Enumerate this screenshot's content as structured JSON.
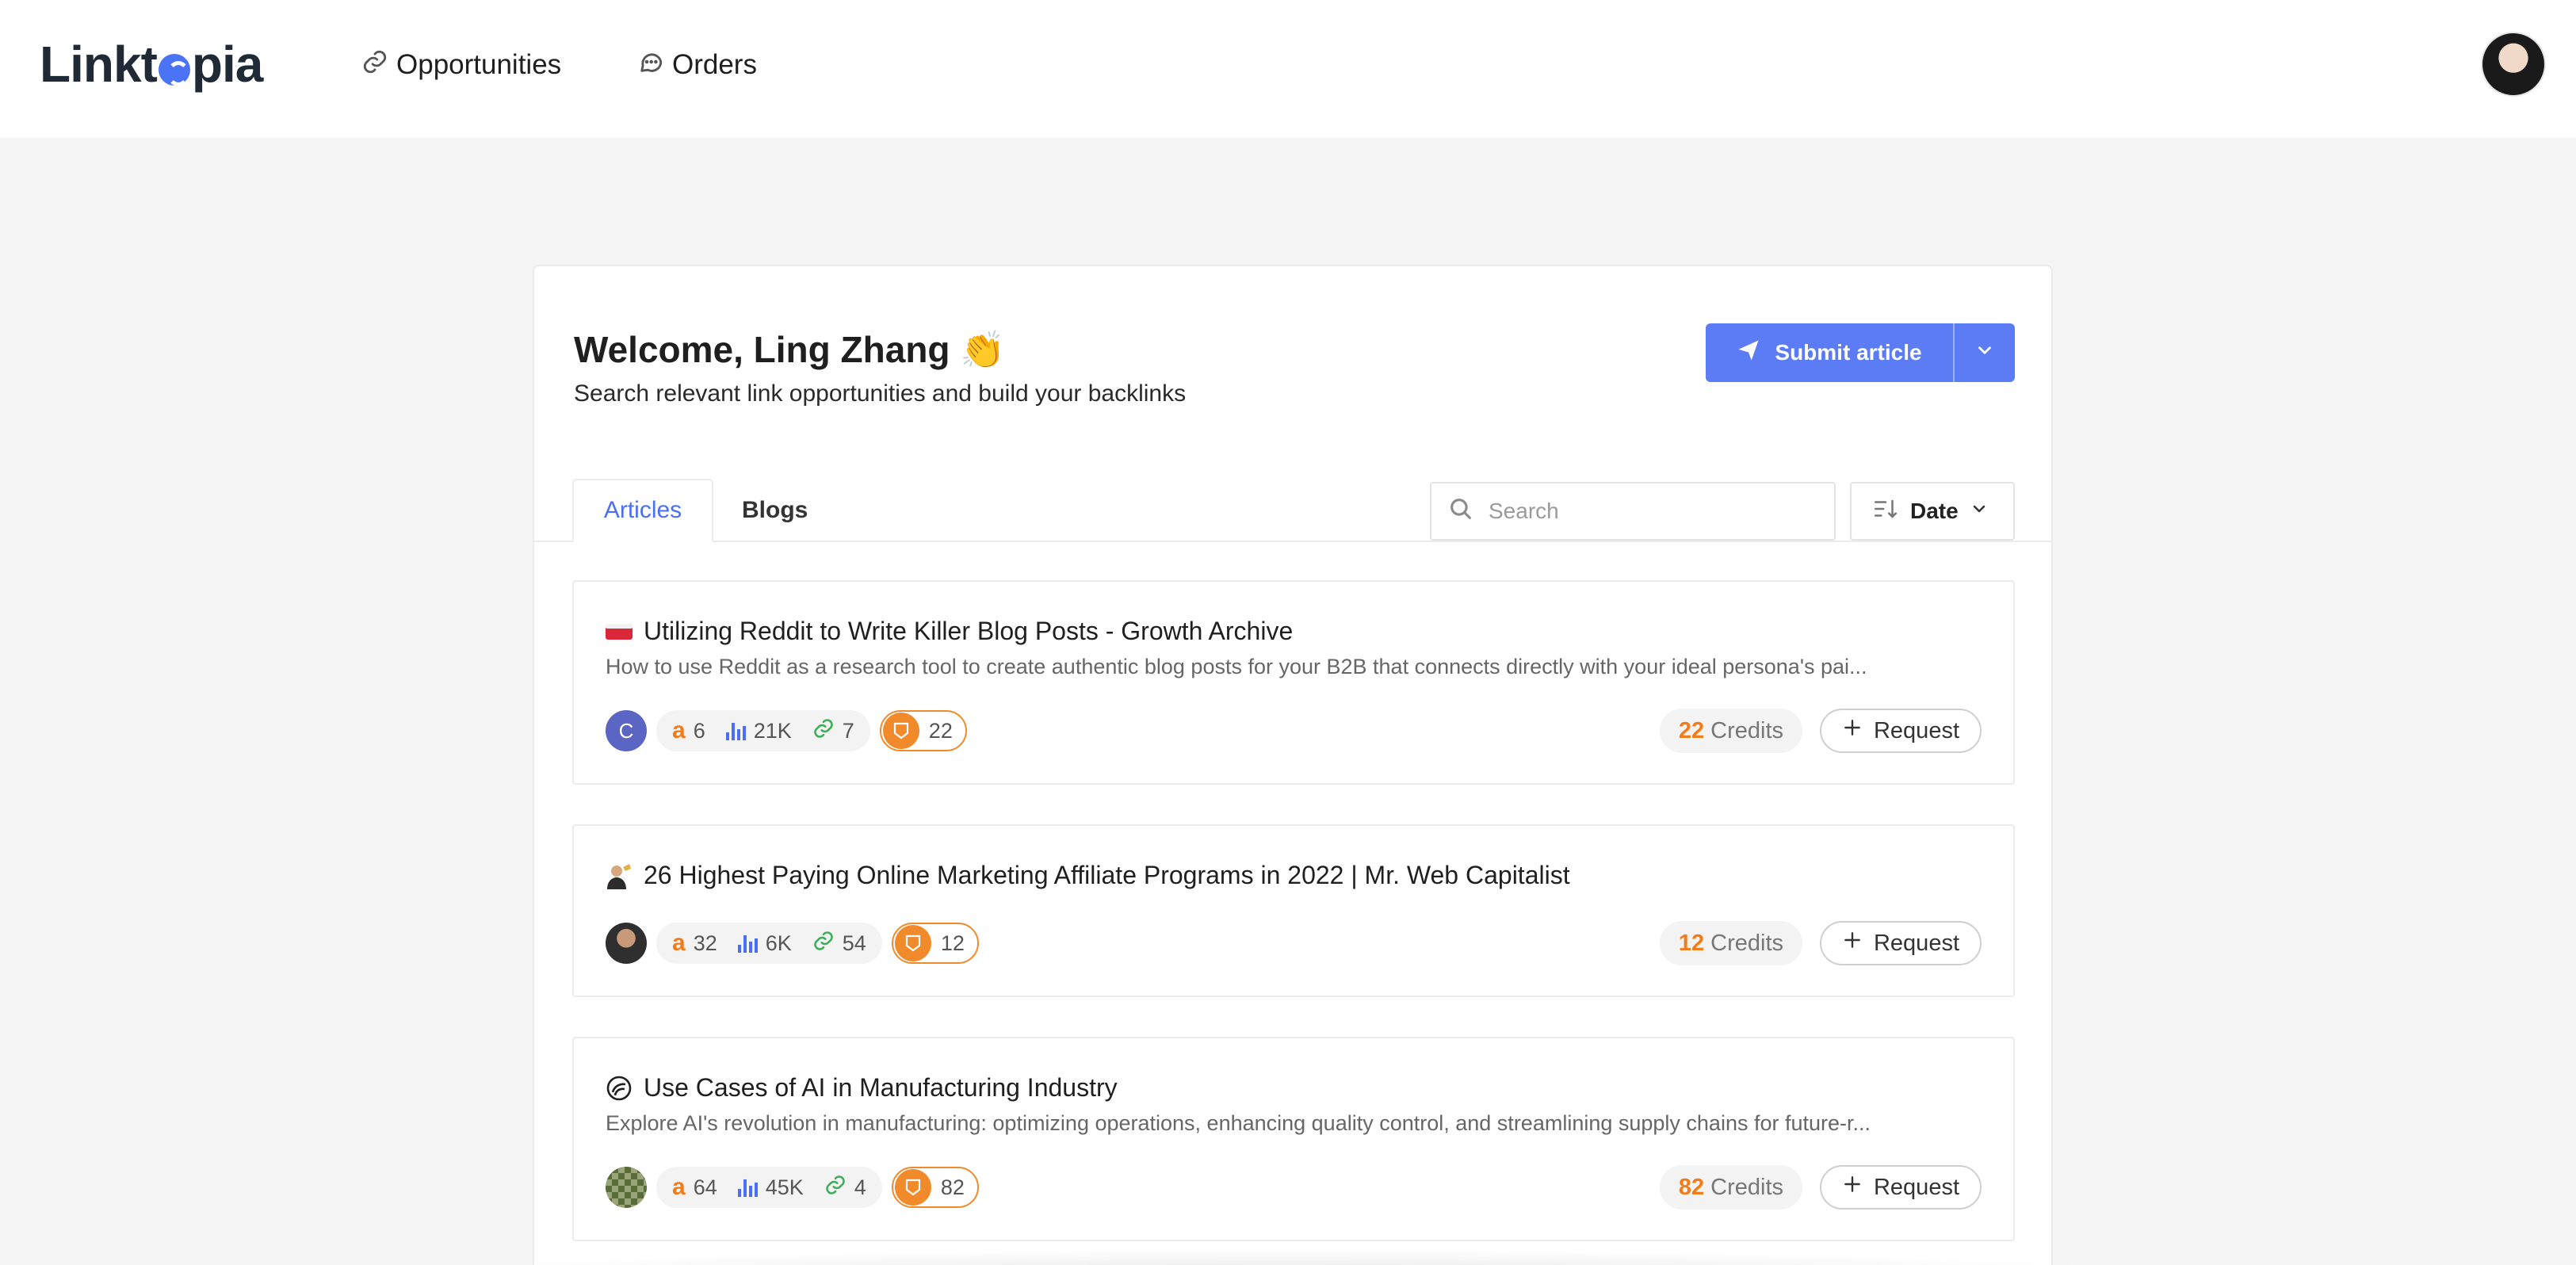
{
  "app": {
    "logo_text_left": "Linkt",
    "logo_text_right": "pia"
  },
  "nav": {
    "items": [
      {
        "label": "Opportunities",
        "icon": "link-icon"
      },
      {
        "label": "Orders",
        "icon": "chat-bubble-icon"
      }
    ]
  },
  "header": {
    "welcome": "Welcome, Ling Zhang 👏",
    "subtitle": "Search relevant link opportunities and build your backlinks",
    "submit_label": "Submit article"
  },
  "tabs": [
    {
      "label": "Articles",
      "active": true
    },
    {
      "label": "Blogs",
      "active": false
    }
  ],
  "search": {
    "placeholder": "Search"
  },
  "sort": {
    "label": "Date"
  },
  "articles": [
    {
      "favicon": "🟥",
      "title": "Utilizing Reddit to Write Killer Blog Posts - Growth Archive",
      "description": "How to use Reddit as a research tool to create authentic blog posts for your B2B that connects directly with your ideal persona's pai...",
      "author_initial": "C",
      "author_color": "#5b65c4",
      "authority": "6",
      "traffic": "21K",
      "links": "7",
      "score": "22",
      "credits_value": "22",
      "credits_label": "Credits",
      "request_label": "Request"
    },
    {
      "favicon": "👨‍💼",
      "title": "26 Highest Paying Online Marketing Affiliate Programs in 2022 | Mr. Web Capitalist",
      "description": "",
      "author_initial": "",
      "author_color": "#3b3b3b",
      "authority": "32",
      "traffic": "6K",
      "links": "54",
      "score": "12",
      "credits_value": "12",
      "credits_label": "Credits",
      "request_label": "Request"
    },
    {
      "favicon": "◎",
      "title": "Use Cases of AI in Manufacturing Industry",
      "description": "Explore AI's revolution in manufacturing: optimizing operations, enhancing quality control, and streamlining supply chains for future-r...",
      "author_initial": "",
      "author_color": "#5a6b3a",
      "authority": "64",
      "traffic": "45K",
      "links": "4",
      "score": "82",
      "credits_value": "82",
      "credits_label": "Credits",
      "request_label": "Request"
    }
  ],
  "colors": {
    "accent": "#5b7cf5",
    "tab_active": "#4a6ff0",
    "credits": "#f07c1a",
    "score_border": "#f08a2a",
    "link_green": "#3fae5a"
  }
}
